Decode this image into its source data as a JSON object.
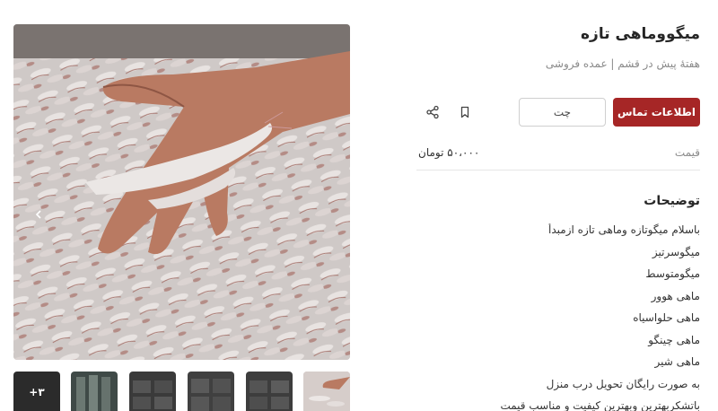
{
  "listing": {
    "title": "میگووماهی تازه",
    "subtitle": "هفتهٔ پیش در قشم | عمده فروشی"
  },
  "actions": {
    "contact_label": "اطلاعات تماس",
    "chat_label": "چت",
    "bookmark_icon": "bookmark-icon",
    "share_icon": "share-icon"
  },
  "price": {
    "label": "قیمت",
    "value": "۵۰،۰۰۰ تومان"
  },
  "description": {
    "heading": "توضیحات",
    "lines": [
      "باسلام میگوتازه وماهی تازه ازمبدأ",
      "میگوسرتیز",
      "میگومتوسط",
      "ماهی هوور",
      "ماهی حلواسیاه",
      "ماهی چینگو",
      "ماهی شیر",
      "به صورت رایگان تحویل درب منزل",
      "باتشکربهترین وبهترین کیفیت و مناسب قیمت"
    ]
  },
  "gallery": {
    "more_count": "+۳",
    "thumbnail_count": 6,
    "slide_count": 2,
    "active_slide": 1
  },
  "colors": {
    "primary": "#a62626",
    "border": "#cfcfcf",
    "muted_text": "#8a8a8a"
  }
}
